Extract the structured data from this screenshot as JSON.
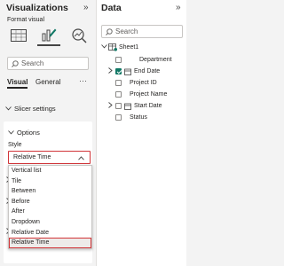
{
  "viz_pane": {
    "title": "Visualizations",
    "collapse_glyph": "»",
    "format_visual_label": "Format visual",
    "search_placeholder": "Search",
    "tabs": [
      {
        "label": "Visual",
        "active": true
      },
      {
        "label": "General",
        "active": false
      }
    ],
    "more_glyph": "···",
    "slicer_settings": "Slicer settings",
    "options": "Options",
    "style_label": "Style",
    "style_selected": "Relative Time",
    "style_options": [
      "Vertical list",
      "Tile",
      "Between",
      "Before",
      "After",
      "Dropdown",
      "Relative Date",
      "Relative Time"
    ],
    "selected_index": 7
  },
  "data_pane": {
    "title": "Data",
    "collapse_glyph": "»",
    "search_placeholder": "Search",
    "table_name": "Sheet1",
    "fields": [
      {
        "label": "Department",
        "checked": false,
        "expandable": false,
        "icon": "none"
      },
      {
        "label": "End Date",
        "checked": true,
        "expandable": true,
        "icon": "calendar-icon"
      },
      {
        "label": "Project ID",
        "checked": false,
        "expandable": false,
        "icon": "none"
      },
      {
        "label": "Project Name",
        "checked": false,
        "expandable": false,
        "icon": "none"
      },
      {
        "label": "Start Date",
        "checked": false,
        "expandable": true,
        "icon": "calendar-icon"
      },
      {
        "label": "Status",
        "checked": false,
        "expandable": false,
        "icon": "none"
      }
    ]
  },
  "colors": {
    "accent_green": "#117865",
    "highlight_red": "#d13438",
    "pane_bg": "#f3f3f3"
  }
}
